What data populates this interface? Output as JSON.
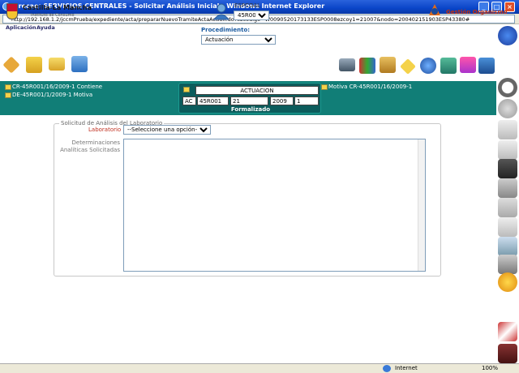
{
  "window": {
    "title": "Grecae: SERVICIOS CENTRALES - Solicitar Análisis Inicial - Windows Internet Explorer",
    "url": "http://192.168.1.2/jccmPrueba/expediente/acta/prepararNuevoTramiteActaAction.do?ezcodigo=W0090520173133ESP0008ezcoy1=21007&nodo=200402151903ESP43380#"
  },
  "menu": {
    "app": "Aplicación",
    "help": "Ayuda"
  },
  "brand": {
    "name": "Castilla-La Mancha",
    "sub": "Instituto de Consumo",
    "org": "Gestión Organismo"
  },
  "user": {
    "name": "ESPCOAL",
    "selected": "45R001"
  },
  "proc": {
    "label": "Procedimiento:",
    "selected": "Actuación"
  },
  "links": {
    "left1": "CR-45R001/16/2009-1 Contiene",
    "left2": "DE-45R001/1/2009-1  Motiva",
    "right1": "Motiva CR-45R001/16/2009-1"
  },
  "act": {
    "title": "ACTUACION",
    "c1": "AC",
    "c2": "45R001",
    "c3": "21",
    "c4": "2009",
    "c5": "1",
    "state": "Formalizado"
  },
  "form": {
    "legend": "Solicitud de Análisis del Laboratorio",
    "lab_label": "Laboratorio",
    "lab_selected": "--Seleccione una opción--",
    "det_label": "Determinaciones Analíticas Solicitadas"
  },
  "status": {
    "zone": "Internet",
    "zoom": "100%"
  }
}
